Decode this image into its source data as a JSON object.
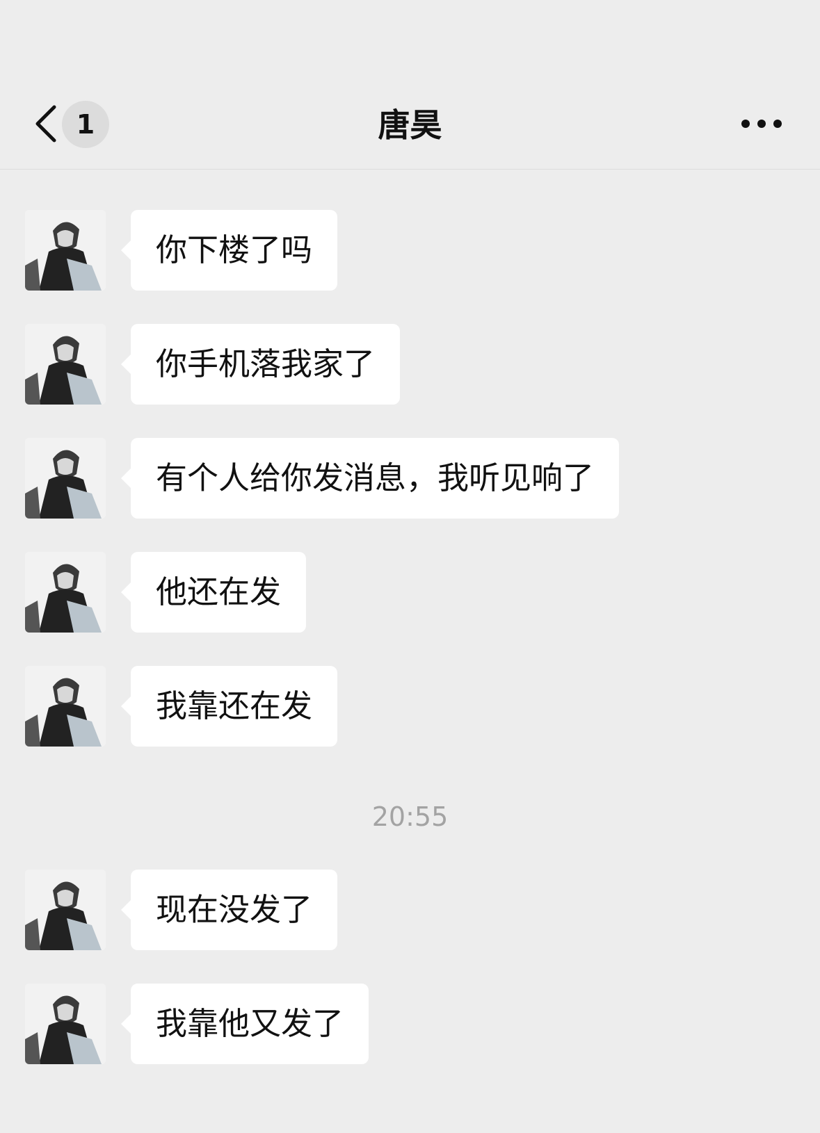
{
  "header": {
    "unread_count": "1",
    "title": "唐昊",
    "back_icon": "chevron-left-icon",
    "more_icon": "more-dots-icon"
  },
  "messages_before": [
    {
      "text": "你下楼了吗"
    },
    {
      "text": "你手机落我家了"
    },
    {
      "text": "有个人给你发消息，我听见响了"
    },
    {
      "text": "他还在发"
    },
    {
      "text": "我靠还在发"
    }
  ],
  "timestamp": "20:55",
  "messages_after": [
    {
      "text": "现在没发了"
    },
    {
      "text": "我靠他又发了"
    }
  ]
}
